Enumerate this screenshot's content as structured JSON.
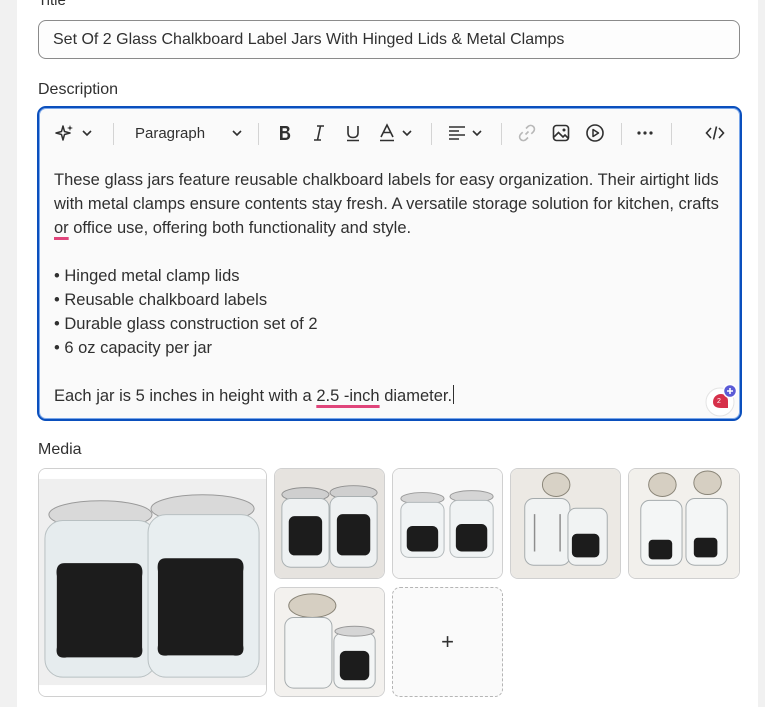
{
  "title_field": {
    "label": "Title",
    "value": "Set Of 2 Glass Chalkboard Label Jars With Hinged Lids & Metal Clamps"
  },
  "description": {
    "label": "Description",
    "toolbar": {
      "ai_icon": "sparkle-icon",
      "format_value": "Paragraph",
      "buttons": [
        "bold-icon",
        "italic-icon",
        "underline-icon",
        "text-color-icon",
        "align-icon",
        "link-icon",
        "image-icon",
        "video-icon",
        "more-icon",
        "code-icon"
      ]
    },
    "paragraph1": "These glass jars feature reusable chalkboard labels for easy organization. Their airtight lids with metal clamps ensure contents stay fresh. A versatile storage solution for kitchen, crafts ",
    "paragraph1_flagged": "or",
    "paragraph1_end": " office use, offering both functionality and style.",
    "bullets": [
      "• Hinged metal clamp lids",
      "• Reusable chalkboard labels",
      "• Durable glass construction set of 2",
      "• 6 oz capacity per jar"
    ],
    "closing_start": "Each jar is 5 inches in height with a ",
    "closing_flagged": "2.5 -inch",
    "closing_end": " diameter.",
    "grammar_badge_count": "2"
  },
  "media": {
    "label": "Media",
    "add_label": "+",
    "images": [
      "product-image-1",
      "product-image-2",
      "product-image-3",
      "product-image-4",
      "product-image-5",
      "product-image-6"
    ]
  },
  "colors": {
    "focus_border": "#0a4fbd",
    "chalk_label": "#1c1c1c",
    "spell_underline": "#e0457b"
  }
}
